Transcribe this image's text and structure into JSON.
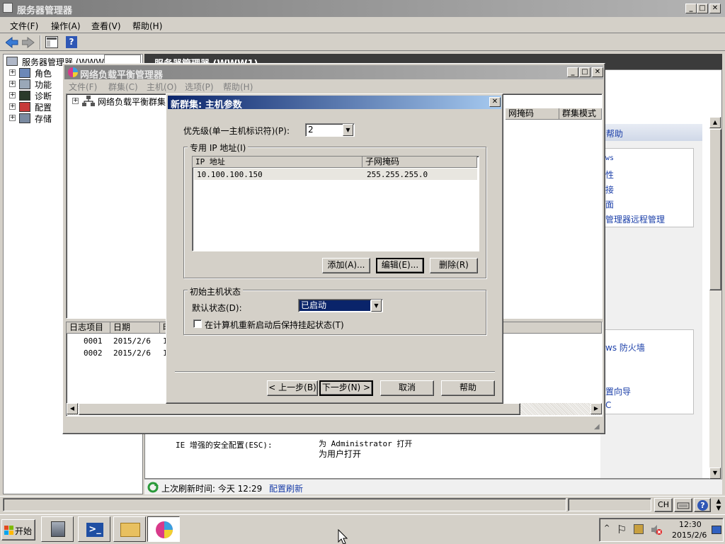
{
  "main_window": {
    "title": "服务器管理器",
    "menu": [
      "文件(F)",
      "操作(A)",
      "查看(V)",
      "帮助(H)"
    ],
    "tree": {
      "root": "服务器管理器 (WWW1)",
      "items": [
        "角色",
        "功能",
        "诊断",
        "配置",
        "存储"
      ]
    },
    "content_header": "服务器管理器 (WWW1)",
    "right_panel": {
      "help": "帮助",
      "links": [
        "ws",
        "性",
        "接",
        "面",
        "管理器远程管理",
        "ws 防火墙",
        "置向导",
        "C"
      ]
    },
    "esc": {
      "label": "IE 增强的安全配置(ESC):",
      "value1": "为 Administrator 打开",
      "value2": "为用户打开"
    },
    "status": {
      "refresh_text": "上次刷新时间: 今天 12:29",
      "refresh_link": "配置刷新"
    }
  },
  "nlb_window": {
    "title": "网络负载平衡管理器",
    "menu": [
      "文件(F)",
      "群集(C)",
      "主机(O)",
      "选项(P)",
      "帮助(H)"
    ],
    "tree_root": "网络负载平衡群集",
    "list_headers": [
      "网掩码",
      "群集模式"
    ],
    "log_headers": [
      "日志项目",
      "日期",
      "时"
    ],
    "log_rows": [
      {
        "id": "0001",
        "date": "2015/2/6",
        "time": "1"
      },
      {
        "id": "0002",
        "date": "2015/2/6",
        "time": "1"
      }
    ]
  },
  "dialog": {
    "title": "新群集: 主机参数",
    "close": "✕",
    "priority_label": "优先级(单一主机标识符)(P):",
    "priority_value": "2",
    "dedicated_ip_group": "专用 IP 地址(I)",
    "ip_headers": [
      "IP 地址",
      "子网掩码"
    ],
    "ip_rows": [
      {
        "ip": "10.100.100.150",
        "mask": "255.255.255.0"
      }
    ],
    "buttons_ip": {
      "add": "添加(A)...",
      "edit": "编辑(E)...",
      "remove": "删除(R)"
    },
    "initial_state_group": "初始主机状态",
    "default_state_label": "默认状态(D):",
    "default_state_value": "已启动",
    "checkbox_label": "在计算机重新启动后保持挂起状态(T)",
    "nav": {
      "back": "< 上一步(B)",
      "next": "下一步(N) >",
      "cancel": "取消",
      "help": "帮助"
    }
  },
  "taskbar": {
    "start": "开始",
    "lang": "CH",
    "time": "12:30",
    "date": "2015/2/6"
  }
}
